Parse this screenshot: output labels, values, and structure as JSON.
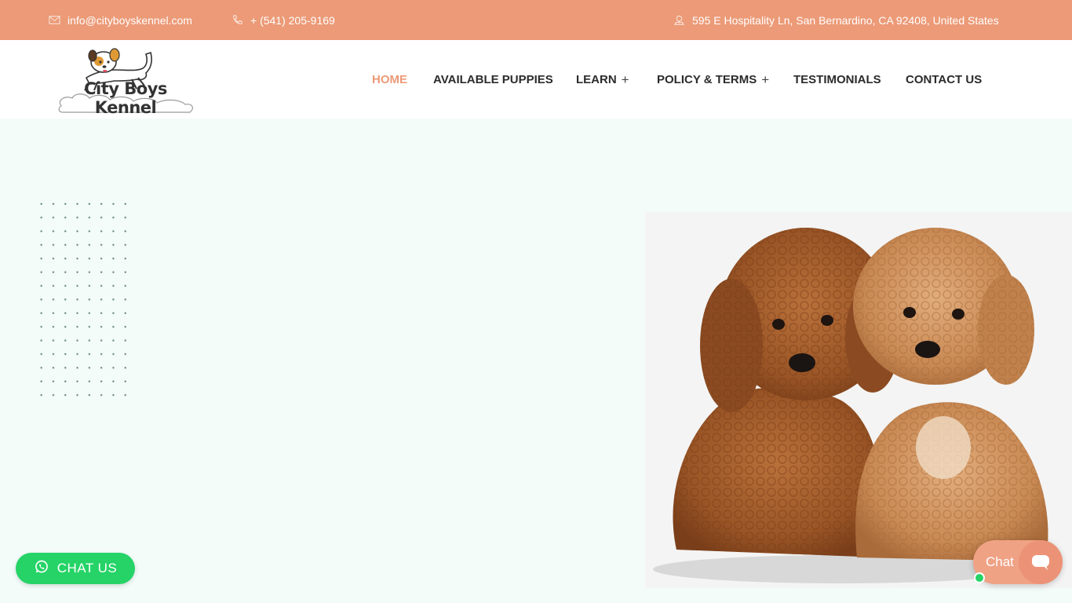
{
  "topbar": {
    "email": "info@cityboyskennel.com",
    "phone": "+ (541) 205-9169",
    "address": "595 E Hospitality Ln, San Bernardino, CA 92408, United States",
    "email_icon": "envelope-icon",
    "phone_icon": "phone-icon",
    "address_icon": "location-pin-icon",
    "bg_color": "#ec9a77"
  },
  "brand": {
    "logo_text": "City Boys Kennel"
  },
  "nav": {
    "items": [
      {
        "label": "HOME",
        "active": true,
        "has_submenu": false
      },
      {
        "label": "AVAILABLE PUPPIES",
        "active": false,
        "has_submenu": false
      },
      {
        "label": "LEARN",
        "active": false,
        "has_submenu": true
      },
      {
        "label": "POLICY & TERMS",
        "active": false,
        "has_submenu": true
      },
      {
        "label": "TESTIMONIALS",
        "active": false,
        "has_submenu": false
      },
      {
        "label": "CONTACT US",
        "active": false,
        "has_submenu": false
      }
    ],
    "submenu_symbol": "+",
    "active_color": "#ec9a77"
  },
  "hero": {
    "image_subject": "two-poodle-puppies-photo",
    "bg_color": "#f3fcf9"
  },
  "chat_us": {
    "label": "CHAT US",
    "icon": "whatsapp-icon",
    "color": "#25d366"
  },
  "chat_widget": {
    "label": "Chat",
    "icon": "chat-bubble-icon",
    "color": "#ec9377"
  }
}
